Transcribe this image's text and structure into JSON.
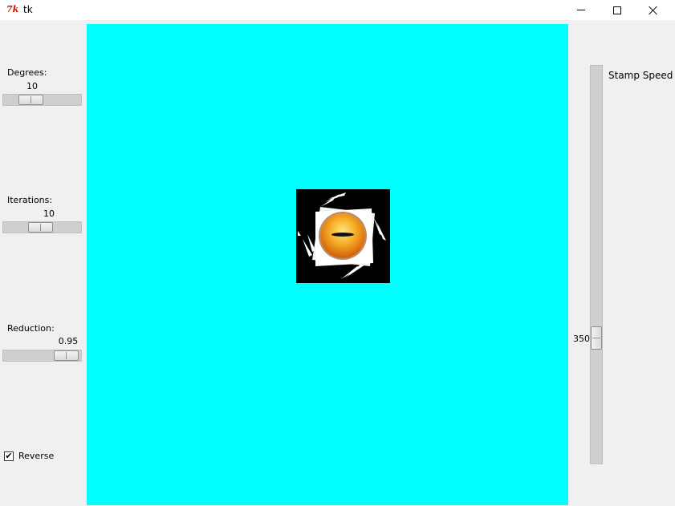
{
  "window": {
    "logo_text": "7k",
    "title": "tk",
    "buttons": [
      "minimize",
      "maximize",
      "close"
    ]
  },
  "controls": {
    "degrees": {
      "label": "Degrees:",
      "value": "10",
      "fraction": 0.29
    },
    "iterations": {
      "label": "Iterations:",
      "value": "10",
      "fraction": 0.47
    },
    "reduction": {
      "label": "Reduction:",
      "value": "0.95",
      "fraction": 0.95
    },
    "reverse": {
      "label": "Reverse",
      "checked": true,
      "mark": "✔"
    },
    "stamp_speed": {
      "label": "Stamp Speed",
      "value": "350",
      "fraction": 0.7
    }
  },
  "canvas": {
    "background": "#00ffff",
    "stamp": "cat-eye-image"
  },
  "icons": {
    "logo": "tk-feather-icon",
    "minimize": "minimize-icon",
    "maximize": "maximize-icon",
    "close": "close-icon"
  }
}
